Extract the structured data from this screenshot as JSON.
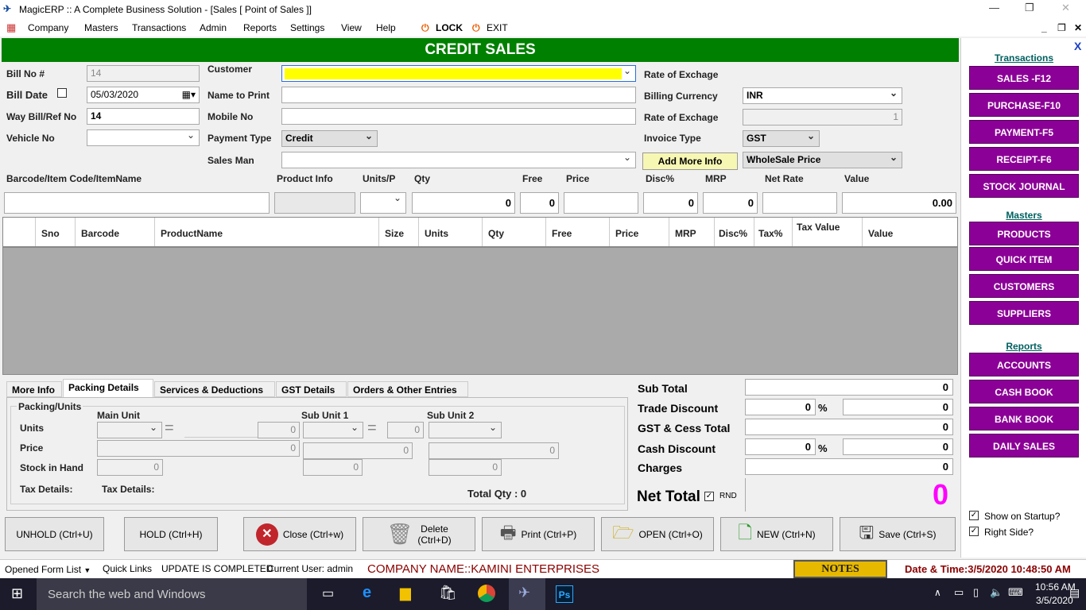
{
  "window": {
    "title": "MagicERP :: A Complete Business Solution - [Sales [ Point of Sales ]]"
  },
  "menu": {
    "company": "Company",
    "masters": "Masters",
    "transactions": "Transactions",
    "admin": "Admin",
    "reports": "Reports",
    "settings": "Settings",
    "view": "View",
    "help": "Help",
    "lock": "LOCK",
    "exit": "EXIT"
  },
  "header": {
    "title": "CREDIT SALES"
  },
  "form": {
    "bill_no_label": "Bill No #",
    "bill_no": "14",
    "bill_date_label": "Bill Date",
    "bill_date": "05/03/2020",
    "waybill_label": "Way Bill/Ref No",
    "waybill": "14",
    "vehicle_label": "Vehicle No",
    "customer_label": "Customer",
    "name_print_label": "Name to Print",
    "mobile_label": "Mobile No",
    "payment_type_label": "Payment Type",
    "payment_type": "Credit",
    "salesman_label": "Sales Man",
    "rate_exchange_label": "Rate of Exchage",
    "billing_currency_label": "Billing Currency",
    "billing_currency": "INR",
    "rate_exchange2_label": "Rate of Exchage",
    "rate_exchange2": "1",
    "invoice_type_label": "Invoice Type",
    "invoice_type": "GST",
    "add_more_info": "Add More Info",
    "price_type": "WholeSale Price"
  },
  "entry": {
    "barcode_label": "Barcode/Item Code/ItemName",
    "product_info_label": "Product Info",
    "units_label": "Units/P",
    "qty_label": "Qty",
    "free_label": "Free",
    "price_label": "Price",
    "disc_label": "Disc%",
    "mrp_label": "MRP",
    "netrate_label": "Net Rate",
    "value_label": "Value",
    "qty": "0",
    "free": "0",
    "disc": "0",
    "mrp": "0",
    "value": "0.00"
  },
  "grid": {
    "columns": [
      "Sno",
      "Barcode",
      "ProductName",
      "Size",
      "Units",
      "Qty",
      "Free",
      "Price",
      "MRP",
      "Disc%",
      "Tax%",
      "Tax Value",
      "Value"
    ]
  },
  "tabs": [
    "More Info",
    "Packing Details",
    "Services & Deductions",
    "GST Details",
    "Orders & Other Entries"
  ],
  "packing": {
    "group_label": "Packing/Units",
    "main_unit": "Main Unit",
    "sub_unit1": "Sub Unit 1",
    "sub_unit2": "Sub Unit 2",
    "units_label": "Units",
    "price_label": "Price",
    "stock_label": "Stock in Hand",
    "tax_details1": "Tax Details:",
    "tax_details2": "Tax Details:",
    "total_qty": "Total Qty : 0",
    "zero": "0"
  },
  "summary": {
    "sub_total_label": "Sub Total",
    "sub_total": "0",
    "trade_discount_label": "Trade Discount",
    "trade_discount_pct": "0",
    "trade_discount": "0",
    "gst_label": "GST & Cess Total",
    "gst": "0",
    "cash_discount_label": "Cash Discount",
    "cash_discount_pct": "0",
    "cash_discount": "0",
    "charges_label": "Charges",
    "charges": "0",
    "net_total_label": "Net Total",
    "rnd": "RND",
    "net_total": "0",
    "pct": "%"
  },
  "sidebar": {
    "transactions_head": "Transactions",
    "transactions": [
      "SALES -F12",
      "PURCHASE-F10",
      "PAYMENT-F5",
      "RECEIPT-F6",
      "STOCK JOURNAL"
    ],
    "masters_head": "Masters",
    "masters": [
      "PRODUCTS",
      "QUICK ITEM",
      "CUSTOMERS",
      "SUPPLIERS"
    ],
    "reports_head": "Reports",
    "reports": [
      "ACCOUNTS",
      "CASH BOOK",
      "BANK BOOK",
      "DAILY SALES"
    ],
    "show_startup": "Show on Startup?",
    "right_side": "Right Side?",
    "close": "X"
  },
  "footer": {
    "unhold": "UNHOLD (Ctrl+U)",
    "hold": "HOLD (Ctrl+H)",
    "close": "Close (Ctrl+w)",
    "delete": "Delete\n(Ctrl+D)",
    "print": "Print (Ctrl+P)",
    "open": "OPEN (Ctrl+O)",
    "new": "NEW (Ctrl+N)",
    "save": "Save (Ctrl+S)"
  },
  "status": {
    "opened_forms": "Opened Form List",
    "quick_links": "Quick Links",
    "update": "UPDATE IS COMPLETED",
    "user": "Current User: admin",
    "company": "COMPANY NAME::KAMINI ENTERPRISES",
    "notes": "NOTES",
    "datetime": "Date & Time:3/5/2020 10:48:50 AM"
  },
  "taskbar": {
    "search": "Search the web and Windows",
    "time": "10:56 AM",
    "date": "3/5/2020"
  },
  "colors": {
    "header": "#008000",
    "sidebar_button": "#8b0096",
    "customer_highlight": "#ffff00",
    "net_total": "#ff00ff",
    "company": "#8b0000"
  }
}
